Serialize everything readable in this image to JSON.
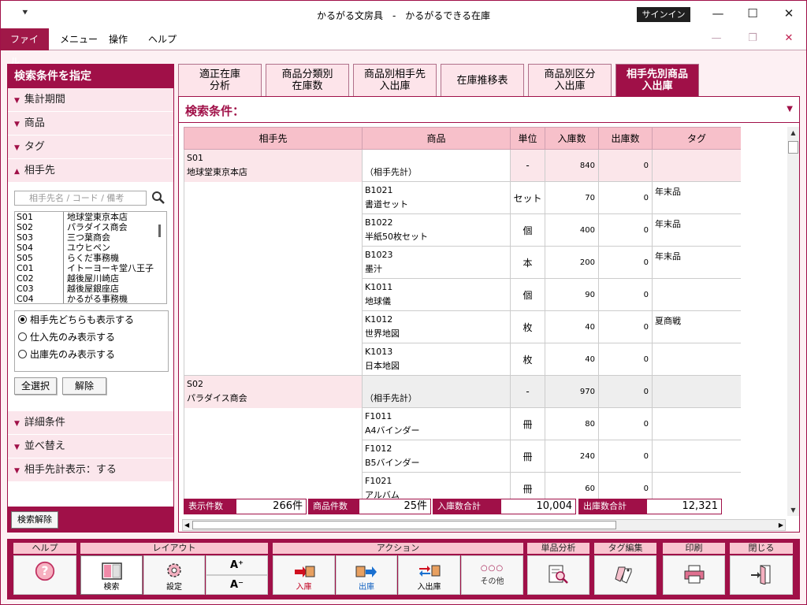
{
  "window": {
    "title": "かるがる文房具　-　かるがるできる在庫",
    "signin": "サインイン",
    "qa": "⯆"
  },
  "menu": {
    "items": [
      "ファイル",
      "メニュー",
      "操作",
      "ヘルプ"
    ]
  },
  "left": {
    "title": "検索条件を指定",
    "sections_top": [
      "集計期間",
      "商品",
      "タグ",
      "相手先"
    ],
    "search_placeholder": "相手先名 / コード / 備考",
    "partners": [
      {
        "code": "S01",
        "name": "地球堂東京本店"
      },
      {
        "code": "S02",
        "name": "パラダイス商会"
      },
      {
        "code": "S03",
        "name": "三つ葉商会"
      },
      {
        "code": "S04",
        "name": "ユウヒペン"
      },
      {
        "code": "S05",
        "name": "らくだ事務機"
      },
      {
        "code": "C01",
        "name": "イトーヨーキ堂八王子"
      },
      {
        "code": "C02",
        "name": "越後屋川崎店"
      },
      {
        "code": "C03",
        "name": "越後屋銀座店"
      },
      {
        "code": "C04",
        "name": "かるがる事務機"
      }
    ],
    "radios": [
      "相手先どちらも表示する",
      "仕入先のみ表示する",
      "出庫先のみ表示する"
    ],
    "select_all": "全選択",
    "deselect": "解除",
    "sections_bottom": [
      "詳細条件",
      "並べ替え",
      "相手先計表示：する"
    ],
    "clear": "検索解除"
  },
  "tabs": [
    "適正在庫\n分析",
    "商品分類別\n在庫数",
    "商品別相手先\n入出庫",
    "在庫推移表",
    "商品別区分\n入出庫",
    "相手先別商品\n入出庫"
  ],
  "search_condition": "検索条件：",
  "columns": [
    "相手先",
    "商品",
    "単位",
    "入庫数",
    "出庫数",
    "タグ"
  ],
  "groups": [
    {
      "code": "S01",
      "name": "地球堂東京本店",
      "total": {
        "label": "（相手先計）",
        "unit": "-",
        "in": "840",
        "out": "0"
      },
      "rows": [
        {
          "code": "B1021",
          "name": "書道セット",
          "unit": "セット",
          "in": "70",
          "out": "0",
          "tag": "年末品"
        },
        {
          "code": "B1022",
          "name": "半紙50枚セット",
          "unit": "個",
          "in": "400",
          "out": "0",
          "tag": "年末品"
        },
        {
          "code": "B1023",
          "name": "墨汁",
          "unit": "本",
          "in": "200",
          "out": "0",
          "tag": "年末品"
        },
        {
          "code": "K1011",
          "name": "地球儀",
          "unit": "個",
          "in": "90",
          "out": "0",
          "tag": ""
        },
        {
          "code": "K1012",
          "name": "世界地図",
          "unit": "枚",
          "in": "40",
          "out": "0",
          "tag": "夏商戦"
        },
        {
          "code": "K1013",
          "name": "日本地図",
          "unit": "枚",
          "in": "40",
          "out": "0",
          "tag": ""
        }
      ]
    },
    {
      "code": "S02",
      "name": "パラダイス商会",
      "total": {
        "label": "（相手先計）",
        "unit": "-",
        "in": "970",
        "out": "0"
      },
      "rows": [
        {
          "code": "F1011",
          "name": "A4バインダー",
          "unit": "冊",
          "in": "80",
          "out": "0",
          "tag": ""
        },
        {
          "code": "F1012",
          "name": "B5バインダー",
          "unit": "冊",
          "in": "240",
          "out": "0",
          "tag": ""
        },
        {
          "code": "F1021",
          "name": "アルバム",
          "unit": "冊",
          "in": "60",
          "out": "0",
          "tag": ""
        }
      ]
    }
  ],
  "stats": {
    "count_label": "表示件数",
    "count": "266件",
    "prod_label": "商品件数",
    "prod": "25件",
    "in_label": "入庫数合計",
    "in": "10,004",
    "out_label": "出庫数合計",
    "out": "12,321"
  },
  "toolbar": {
    "help": "ヘルプ",
    "layout": "レイアウト",
    "search": "検索",
    "settings": "設定",
    "font_up": "A⁺",
    "font_down": "A⁻",
    "action": "アクション",
    "in": "入庫",
    "out": "出庫",
    "inout": "入出庫",
    "other": "その他",
    "other_dots": "○○○",
    "analysis": "単品分析",
    "tag_edit": "タグ編集",
    "print": "印刷",
    "close": "閉じる"
  }
}
